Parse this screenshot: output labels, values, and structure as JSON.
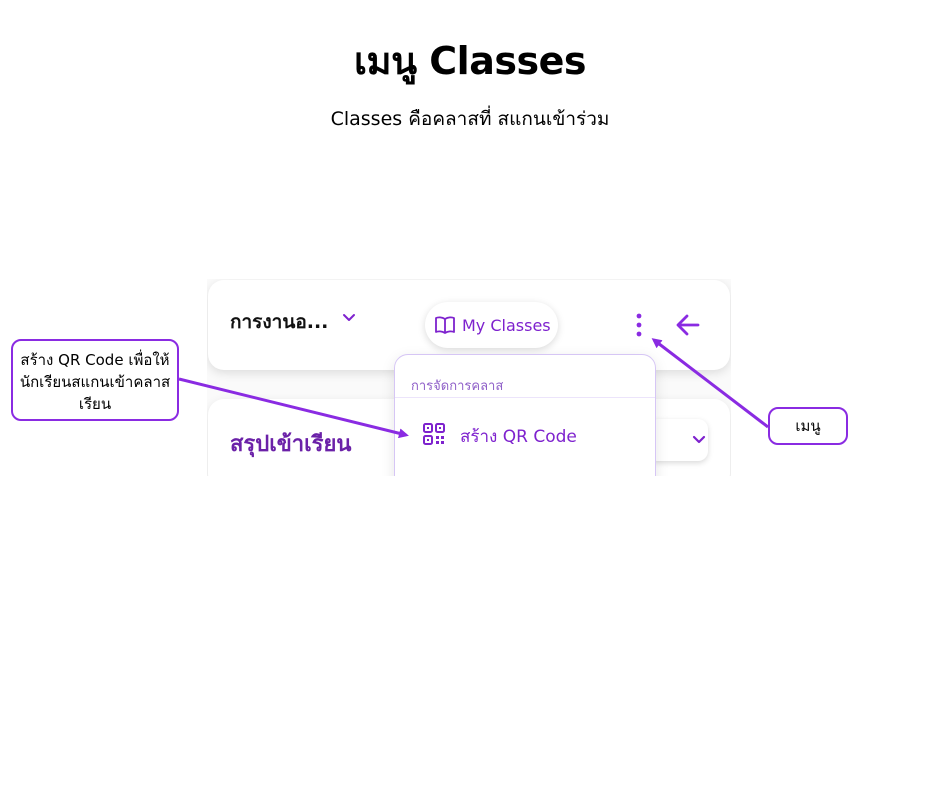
{
  "header": {
    "title": "เมนู Classes",
    "subtitle": "Classes คือคลาสที่ สแกนเข้าร่วม"
  },
  "screenshot": {
    "topbar": {
      "class_name": "การงานอ...",
      "my_classes_label": "My Classes"
    },
    "summary": {
      "title": "สรุปเข้าเรียน"
    },
    "dropdown": {
      "header": "การจัดการคลาส",
      "item_label": "สร้าง QR Code"
    }
  },
  "callouts": {
    "qr": "สร้าง QR Code เพื่อให้นักเรียนสแกนเข้าคลาสเรียน",
    "menu": "เมนู"
  },
  "colors": {
    "accent": "#7e22ce",
    "callout_border": "#8a2be2",
    "arrow": "#8a2be2"
  }
}
